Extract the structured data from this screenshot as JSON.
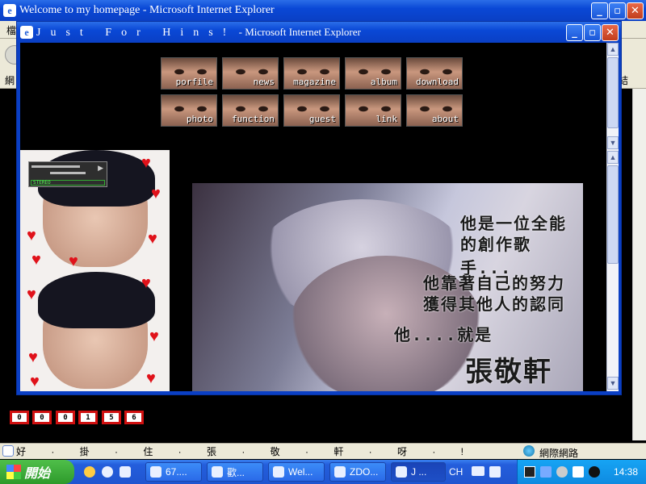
{
  "outer_window": {
    "title": "Welcome to my homepage - Microsoft Internet Explorer",
    "menu_stub": "檔",
    "address_stub": "網",
    "address_right_stub": "結"
  },
  "popup_window": {
    "title_spaced": "Just For Hins!",
    "title_suffix": " - Microsoft Internet Explorer"
  },
  "nav": {
    "row1": [
      "porfile",
      "news",
      "magazine",
      "album",
      "download"
    ],
    "row2": [
      "photo",
      "function",
      "guest",
      "link",
      "about"
    ]
  },
  "player": {
    "label": "STEREO"
  },
  "banner": {
    "line1": "他是一位全能",
    "line2": "的創作歌手...",
    "line3": "他靠著自己的努力",
    "line4": "獲得其他人的認同",
    "line5": "他....就是",
    "name": "張敬軒"
  },
  "counter": [
    "0",
    "0",
    "0",
    "1",
    "5",
    "6"
  ],
  "statusbar": {
    "text": "好 · 掛 · 住 · 張 · 敬 · 軒 · 呀 · !",
    "zone": "網際網路"
  },
  "taskbar": {
    "start": "開始",
    "items": [
      "67....",
      "歡...",
      "Wel...",
      "ZDO...",
      "J ..."
    ],
    "lang": "CH",
    "clock": "14:38"
  }
}
